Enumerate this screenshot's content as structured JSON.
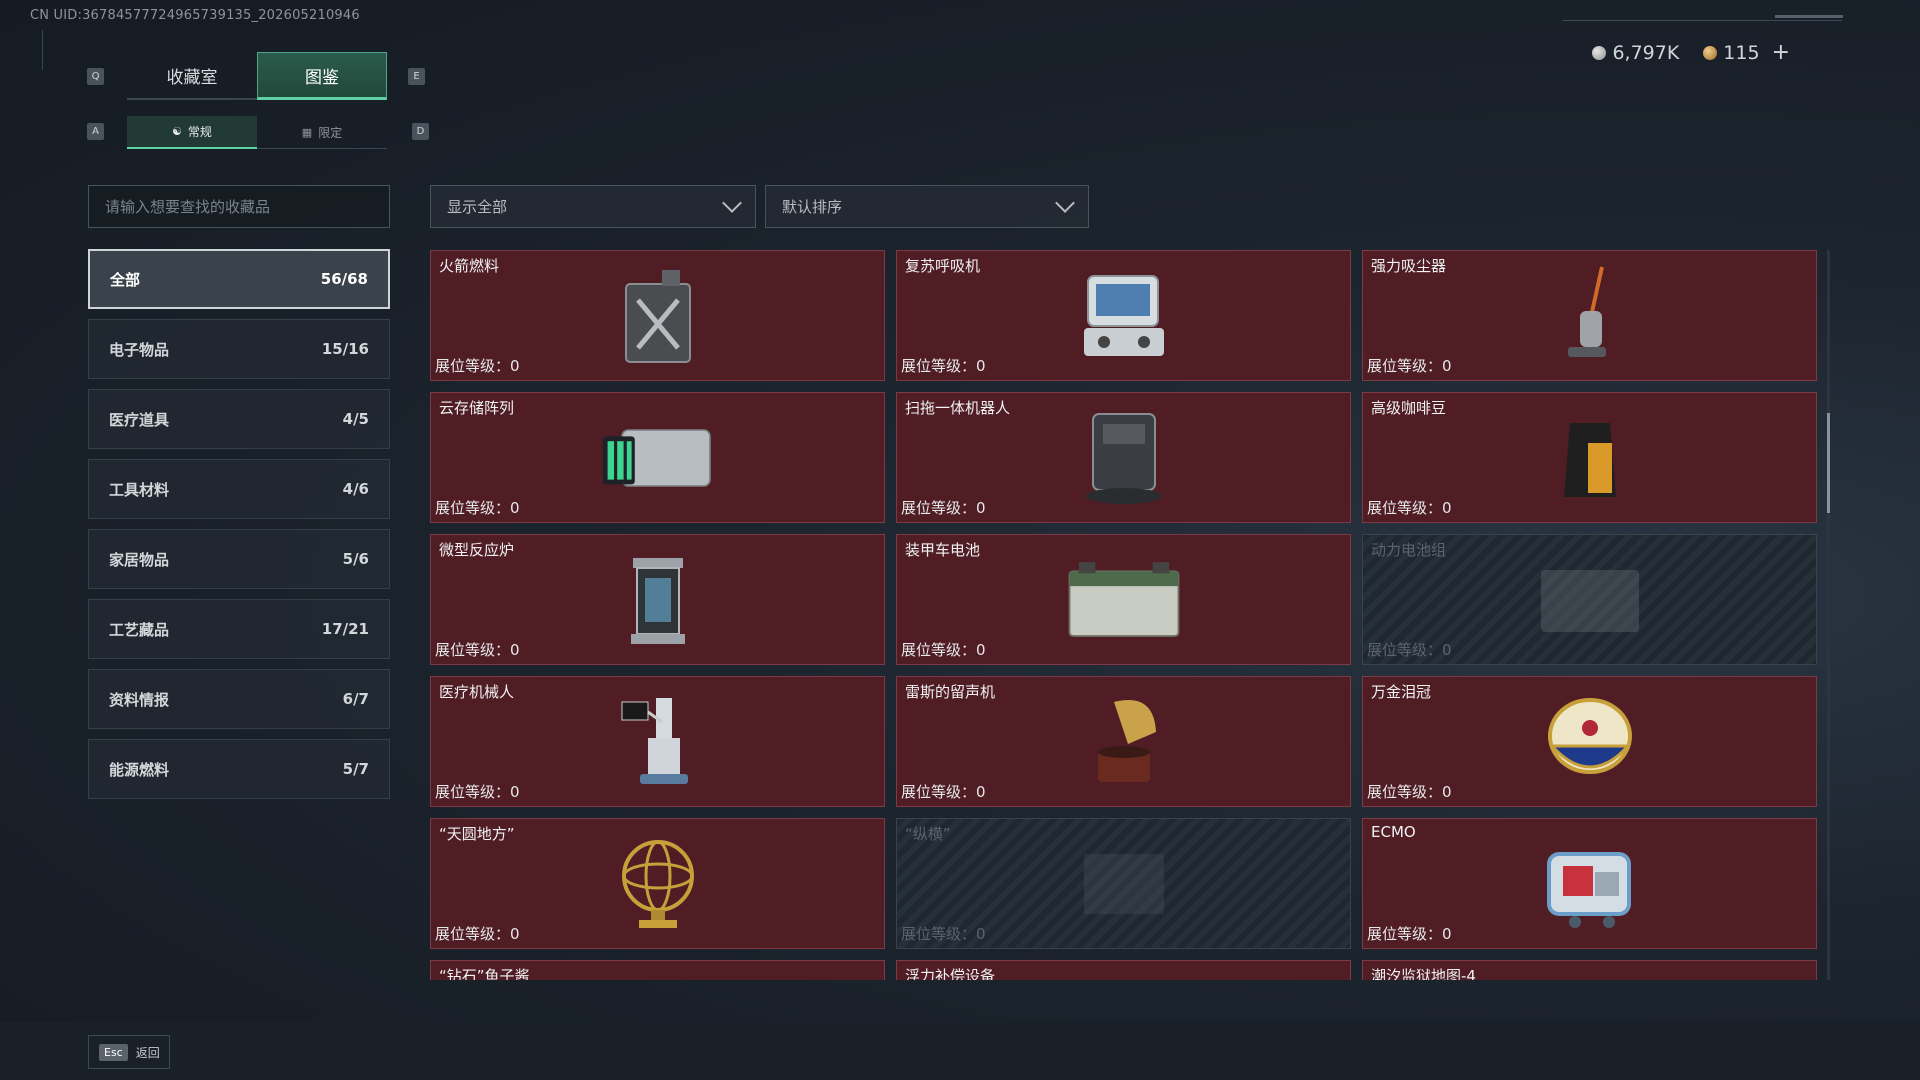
{
  "uid_text": "CN UID:36784577724965739135_202605210946",
  "currency": {
    "silver": "6,797K",
    "gold": "115",
    "plus": "+"
  },
  "key_hints": {
    "prev_tab": "Q",
    "next_tab": "E",
    "prev_sub": "A",
    "next_sub": "D"
  },
  "tabs": [
    {
      "label": "收藏室"
    },
    {
      "label": "图鉴"
    }
  ],
  "subtabs": [
    {
      "label": "常规"
    },
    {
      "label": "限定"
    }
  ],
  "search": {
    "placeholder": "请输入想要查找的收藏品"
  },
  "filter": {
    "label": "显示全部"
  },
  "sort": {
    "label": "默认排序"
  },
  "categories": [
    {
      "label": "全部",
      "count": "56/68"
    },
    {
      "label": "电子物品",
      "count": "15/16"
    },
    {
      "label": "医疗道具",
      "count": "4/5"
    },
    {
      "label": "工具材料",
      "count": "4/6"
    },
    {
      "label": "家居物品",
      "count": "5/6"
    },
    {
      "label": "工艺藏品",
      "count": "17/21"
    },
    {
      "label": "资料情报",
      "count": "6/7"
    },
    {
      "label": "能源燃料",
      "count": "5/7"
    }
  ],
  "items": [
    {
      "name": "火箭燃料",
      "level": "展位等级：0",
      "icon": "fuel-canister-icon"
    },
    {
      "name": "复苏呼吸机",
      "level": "展位等级：0",
      "icon": "ventilator-icon"
    },
    {
      "name": "强力吸尘器",
      "level": "展位等级：0",
      "icon": "vacuum-cleaner-icon"
    },
    {
      "name": "云存储阵列",
      "level": "展位等级：0",
      "icon": "storage-array-icon"
    },
    {
      "name": "扫拖一体机器人",
      "level": "展位等级：0",
      "icon": "mop-robot-icon"
    },
    {
      "name": "高级咖啡豆",
      "level": "展位等级：0",
      "icon": "coffee-bag-icon"
    },
    {
      "name": "微型反应炉",
      "level": "展位等级：0",
      "icon": "reactor-icon"
    },
    {
      "name": "装甲车电池",
      "level": "展位等级：0",
      "icon": "battery-icon"
    },
    {
      "name": "动力电池组",
      "level": "展位等级：0",
      "icon": "battery-pack-icon",
      "locked": true
    },
    {
      "name": "医疗机械人",
      "level": "展位等级：0",
      "icon": "medical-robot-icon"
    },
    {
      "name": "雷斯的留声机",
      "level": "展位等级：0",
      "icon": "gramophone-icon"
    },
    {
      "name": "万金泪冠",
      "level": "展位等级：0",
      "icon": "jeweled-egg-icon"
    },
    {
      "name": "“天圆地方”",
      "level": "展位等级：0",
      "icon": "armillary-sphere-icon"
    },
    {
      "name": "“纵横”",
      "level": "展位等级：0",
      "icon": "chessboard-icon",
      "locked": true
    },
    {
      "name": "ECMO",
      "level": "展位等级：0",
      "icon": "ecmo-machine-icon"
    },
    {
      "name": "“钻石”鱼子酱",
      "level": "",
      "icon": ""
    },
    {
      "name": "浮力补偿设备",
      "level": "",
      "icon": ""
    },
    {
      "name": "潮汐监狱地图-4",
      "level": "",
      "icon": ""
    }
  ],
  "footer": {
    "esc_key": "Esc",
    "back_label": "返回"
  },
  "colors": {
    "accent": "#5fd0a2",
    "card_bg": "#501d25",
    "card_border": "#7b3a44"
  }
}
